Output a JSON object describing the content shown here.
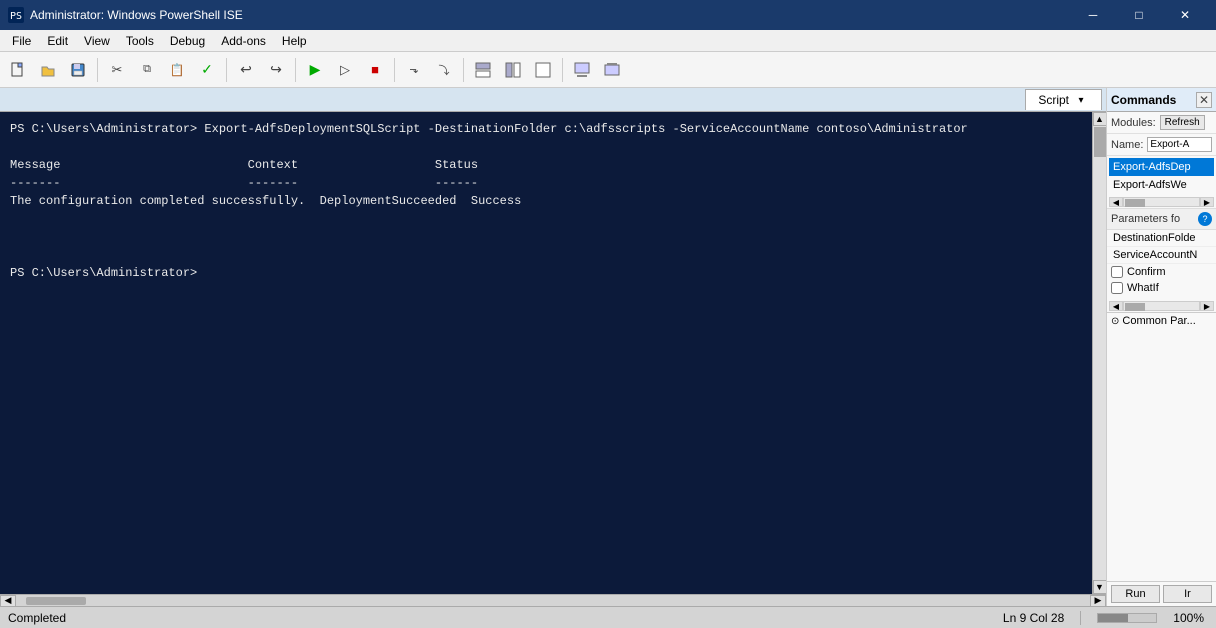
{
  "window": {
    "title": "Administrator: Windows PowerShell ISE",
    "icon": "powershell-icon"
  },
  "titlebar": {
    "minimize_label": "─",
    "maximize_label": "□",
    "close_label": "✕"
  },
  "menubar": {
    "items": [
      "File",
      "Edit",
      "View",
      "Tools",
      "Debug",
      "Add-ons",
      "Help"
    ]
  },
  "toolbar": {
    "buttons": [
      {
        "name": "new-button",
        "icon": "📄"
      },
      {
        "name": "open-button",
        "icon": "📂"
      },
      {
        "name": "save-button",
        "icon": "💾"
      },
      {
        "name": "cut-button",
        "icon": "✂"
      },
      {
        "name": "copy-button",
        "icon": "📋"
      },
      {
        "name": "paste-button",
        "icon": "📌"
      },
      {
        "name": "checkmark-button",
        "icon": "✓"
      },
      {
        "name": "undo-button",
        "icon": "↩"
      },
      {
        "name": "redo-button",
        "icon": "↪"
      },
      {
        "name": "run-button",
        "icon": "▶"
      },
      {
        "name": "run-selection-button",
        "icon": "▷"
      },
      {
        "name": "stop-button",
        "icon": "■"
      },
      {
        "name": "debug1-button",
        "icon": "⬛"
      },
      {
        "name": "debug2-button",
        "icon": "⏭"
      },
      {
        "name": "zoom-in-button",
        "icon": "⬜"
      },
      {
        "name": "zoom-out-button",
        "icon": "⬛"
      },
      {
        "name": "expand-button",
        "icon": "⬜"
      },
      {
        "name": "collapse-button",
        "icon": "⬛"
      }
    ]
  },
  "console": {
    "tab_label": "Script",
    "content_lines": [
      "PS C:\\Users\\Administrator> Export-AdfsDeploymentSQLScript -DestinationFolder c:\\adfsscripts -ServiceAccountName contoso\\Administrator",
      "",
      "Message                          Context                   Status",
      "-------                          -------                   ------",
      "The configuration completed successfully.  DeploymentSucceeded  Success",
      "",
      "",
      "",
      "PS C:\\Users\\Administrator>"
    ]
  },
  "commands_panel": {
    "title": "Commands",
    "close_label": "✕",
    "modules_label": "Modules:",
    "refresh_label": "Refresh",
    "name_label": "Name:",
    "name_value": "Export-A",
    "list_items": [
      {
        "label": "Export-AdfsDep",
        "selected": true
      },
      {
        "label": "Export-AdfsWe",
        "selected": false
      }
    ],
    "params_label": "Parameters fo",
    "help_label": "?",
    "params": [
      {
        "label": "DestinationFolde"
      },
      {
        "label": "ServiceAccountN"
      }
    ],
    "checkboxes": [
      {
        "label": "Confirm",
        "checked": false
      },
      {
        "label": "WhatIf",
        "checked": false
      }
    ],
    "common_params_label": "Common Par...",
    "run_label": "Run",
    "copy_label": "Ir"
  },
  "statusbar": {
    "status_text": "Completed",
    "ln_col": "Ln 9  Col 28",
    "zoom": "100%"
  }
}
